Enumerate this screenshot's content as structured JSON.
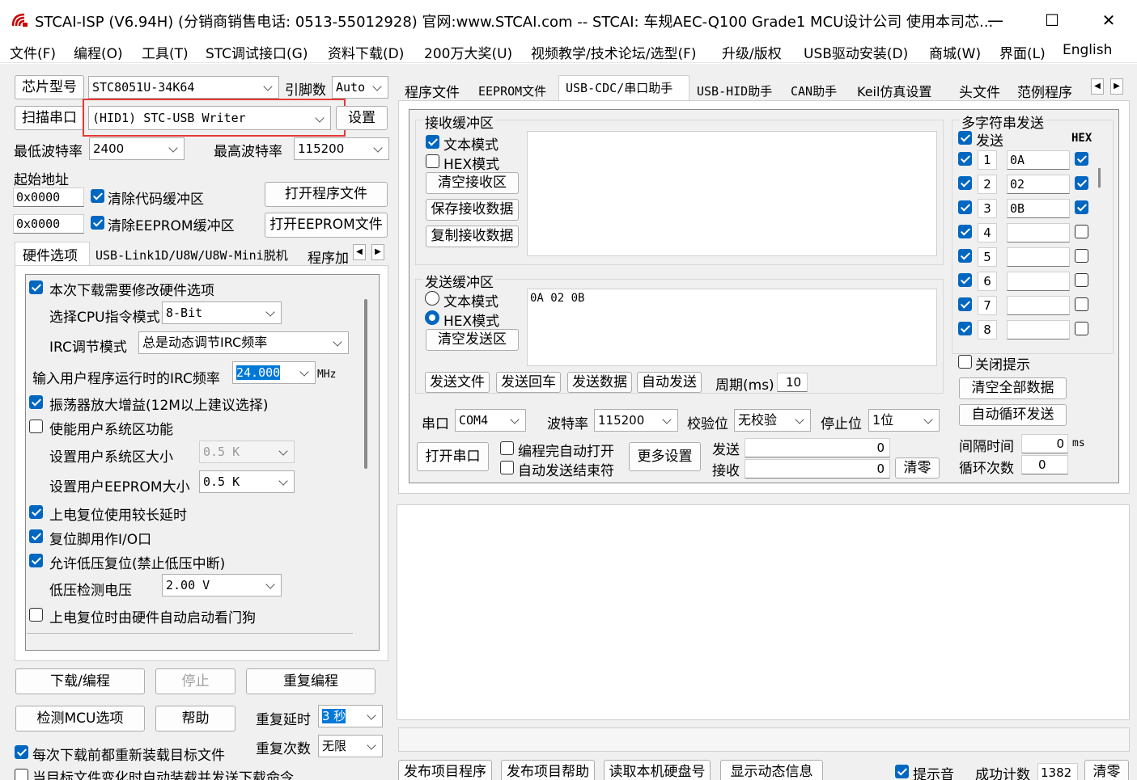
{
  "window": {
    "title": "STCAI-ISP (V6.94H) (分销商销售电话: 0513-55012928) 官网:www.STCAI.com  -- STCAI: 车规AEC-Q100 Grade1 MCU设计公司 使用本司芯...",
    "min": "—",
    "max": "☐",
    "close": "✕"
  },
  "menu": [
    "文件(F)",
    "编程(O)",
    "工具(T)",
    "STC调试接口(G)",
    "资料下载(D)",
    "200万大奖(U)",
    "视频教学/技术论坛/选型(F)",
    "升级/版权",
    "USB驱动安装(D)",
    "商城(W)",
    "界面(L)",
    "English"
  ],
  "left": {
    "chip_label": "芯片型号",
    "chip_value": "STC8051U-34K64",
    "pin_label": "引脚数",
    "pin_value": "Auto",
    "scan_label": "扫描串口",
    "port_value": "(HID1) STC-USB Writer",
    "settings_label": "设置",
    "min_baud_label": "最低波特率",
    "min_baud_value": "2400",
    "max_baud_label": "最高波特率",
    "max_baud_value": "115200",
    "start_addr_label": "起始地址",
    "addr1": "0x0000",
    "addr2": "0x0000",
    "clear_code_label": "清除代码缓冲区",
    "clear_eeprom_label": "清除EEPROM缓冲区",
    "open_prog_label": "打开程序文件",
    "open_eeprom_label": "打开EEPROM文件",
    "tabs": [
      "硬件选项",
      "USB-Link1D/U8W/U8W-Mini脱机",
      "程序加"
    ],
    "hw": {
      "modify_label": "本次下载需要修改硬件选项",
      "cpu_mode_label": "选择CPU指令模式",
      "cpu_mode_value": "8-Bit",
      "irc_mode_label": "IRC调节模式",
      "irc_mode_value": "总是动态调节IRC频率",
      "irc_freq_label": "输入用户程序运行时的IRC频率",
      "irc_freq_value": "24.000",
      "irc_unit": "MHz",
      "osc_gain_label": "振荡器放大增益(12M以上建议选择)",
      "user_sys_label": "使能用户系统区功能",
      "user_sys_size_label": "设置用户系统区大小",
      "user_sys_size_value": "0.5 K",
      "user_eeprom_label": "设置用户EEPROM大小",
      "user_eeprom_value": "0.5 K",
      "long_reset_label": "上电复位使用较长延时",
      "reset_pin_label": "复位脚用作I/O口",
      "lvd_label": "允许低压复位(禁止低压中断)",
      "lvd_volt_label": "低压检测电压",
      "lvd_volt_value": "2.00 V",
      "wdt_label": "上电复位时由硬件自动启动看门狗"
    },
    "download_label": "下载/编程",
    "stop_label": "停止",
    "repeat_prog_label": "重复编程",
    "check_mcu_label": "检测MCU选项",
    "help_label": "帮助",
    "repeat_delay_label": "重复延时",
    "repeat_delay_value": "3 秒",
    "repeat_count_label": "重复次数",
    "repeat_count_value": "无限",
    "reload_label": "每次下载前都重新装载目标文件",
    "auto_load_label": "当目标文件变化时自动装载并发送下载命令"
  },
  "right": {
    "tabs": [
      "程序文件",
      "EEPROM文件",
      "USB-CDC/串口助手",
      "USB-HID助手",
      "CAN助手",
      "Keil仿真设置",
      "头文件",
      "范例程序"
    ],
    "recv": {
      "title": "接收缓冲区",
      "text_mode": "文本模式",
      "hex_mode": "HEX模式",
      "clear": "清空接收区",
      "save": "保存接收数据",
      "copy": "复制接收数据"
    },
    "send": {
      "title": "发送缓冲区",
      "text_mode": "文本模式",
      "hex_mode": "HEX模式",
      "clear": "清空发送区",
      "content": "0A 02 0B"
    },
    "actions": {
      "send_file": "发送文件",
      "send_enter": "发送回车",
      "send_data": "发送数据",
      "auto_send": "自动发送",
      "period_label": "周期(ms)",
      "period_value": "10"
    },
    "serial": {
      "port_label": "串口",
      "port_value": "COM4",
      "baud_label": "波特率",
      "baud_value": "115200",
      "parity_label": "校验位",
      "parity_value": "无校验",
      "stop_label": "停止位",
      "stop_value": "1位",
      "open_label": "打开串口",
      "auto_open_label": "编程完自动打开",
      "auto_send_end_label": "自动发送结束符",
      "more_label": "更多设置",
      "tx_label": "发送",
      "tx_value": "0",
      "rx_label": "接收",
      "rx_value": "0",
      "clear_label": "清零"
    },
    "multi": {
      "title": "多字符串发送",
      "send_label": "发送",
      "hex_label": "HEX",
      "rows": [
        {
          "n": "1",
          "v": "0A",
          "hex": true
        },
        {
          "n": "2",
          "v": "02",
          "hex": true
        },
        {
          "n": "3",
          "v": "0B",
          "hex": true
        },
        {
          "n": "4",
          "v": "",
          "hex": false
        },
        {
          "n": "5",
          "v": "",
          "hex": false
        },
        {
          "n": "6",
          "v": "",
          "hex": false
        },
        {
          "n": "7",
          "v": "",
          "hex": false
        },
        {
          "n": "8",
          "v": "",
          "hex": false
        }
      ],
      "close_tip": "关闭提示",
      "clear_all": "清空全部数据",
      "auto_loop": "自动循环发送",
      "interval_label": "间隔时间",
      "interval_value": "0",
      "interval_unit": "ms",
      "loop_label": "循环次数",
      "loop_value": "0"
    },
    "bottom": {
      "publish_prog": "发布项目程序",
      "publish_help": "发布项目帮助",
      "read_disk": "读取本机硬盘号",
      "show_dyn": "显示动态信息",
      "tip_sound": "提示音",
      "success_label": "成功计数",
      "success_value": "1382",
      "clear": "清零"
    }
  }
}
